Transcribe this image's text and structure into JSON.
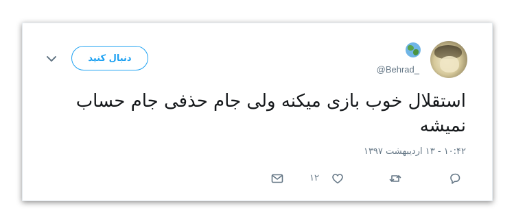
{
  "tweet": {
    "handle": "@Behrad_",
    "follow_label": "دنبال کنید",
    "text": "استقلال خوب بازی میکنه ولی جام حذفی جام حساب نمیشه",
    "timestamp": "۱۰:۴۲ - ۱۳ اردیبهشت ۱۳۹۷",
    "like_count": "۱۲",
    "icons": {
      "avatar": "avatar-image",
      "badge": "globe-icon",
      "menu": "chevron-down-icon",
      "reply": "reply-icon",
      "retweet": "retweet-icon",
      "like": "heart-icon",
      "dm": "mail-icon"
    },
    "colors": {
      "accent": "#1da1f2",
      "secondary_text": "#657786",
      "primary_text": "#14171a"
    }
  }
}
